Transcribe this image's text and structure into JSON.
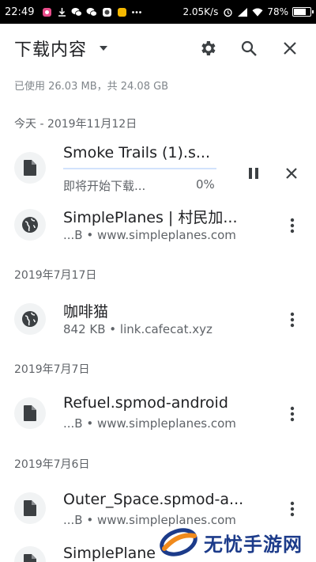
{
  "status_bar": {
    "time": "22:49",
    "net_speed": "2.05K/s",
    "battery_percent": "78%",
    "battery_level": 0.78
  },
  "app_bar": {
    "title": "下载内容",
    "icons": [
      "settings-icon",
      "search-icon",
      "close-icon"
    ]
  },
  "storage_info": "已使用 26.03 MB，共 24.08 GB",
  "sections": [
    {
      "header": "今天 - 2019年11月12日",
      "items": [
        {
          "name": "Smoke Trails (1).s...",
          "status": "即将开始下载...",
          "progress_text": "0%",
          "progress": 0,
          "icon": "file-icon",
          "actions": [
            "pause-icon",
            "cancel-icon"
          ]
        },
        {
          "name": "SimplePlanes | 村民加...",
          "meta": "...B • www.simpleplanes.com",
          "icon": "globe-icon"
        }
      ]
    },
    {
      "header": "2019年7月17日",
      "items": [
        {
          "name": "咖啡猫",
          "meta": "842 KB • link.cafecat.xyz",
          "icon": "globe-icon"
        }
      ]
    },
    {
      "header": "2019年7月7日",
      "items": [
        {
          "name": "Refuel.spmod-android",
          "meta": "...B • www.simpleplanes.com",
          "icon": "file-icon"
        }
      ]
    },
    {
      "header": "2019年7月6日",
      "items": [
        {
          "name": "Outer_Space.spmod-a...",
          "meta": "...B • www.simpleplanes.com",
          "icon": "file-icon"
        },
        {
          "name": "SimplePlane",
          "icon": "file-icon"
        }
      ]
    }
  ],
  "watermark": "无忧手游网"
}
